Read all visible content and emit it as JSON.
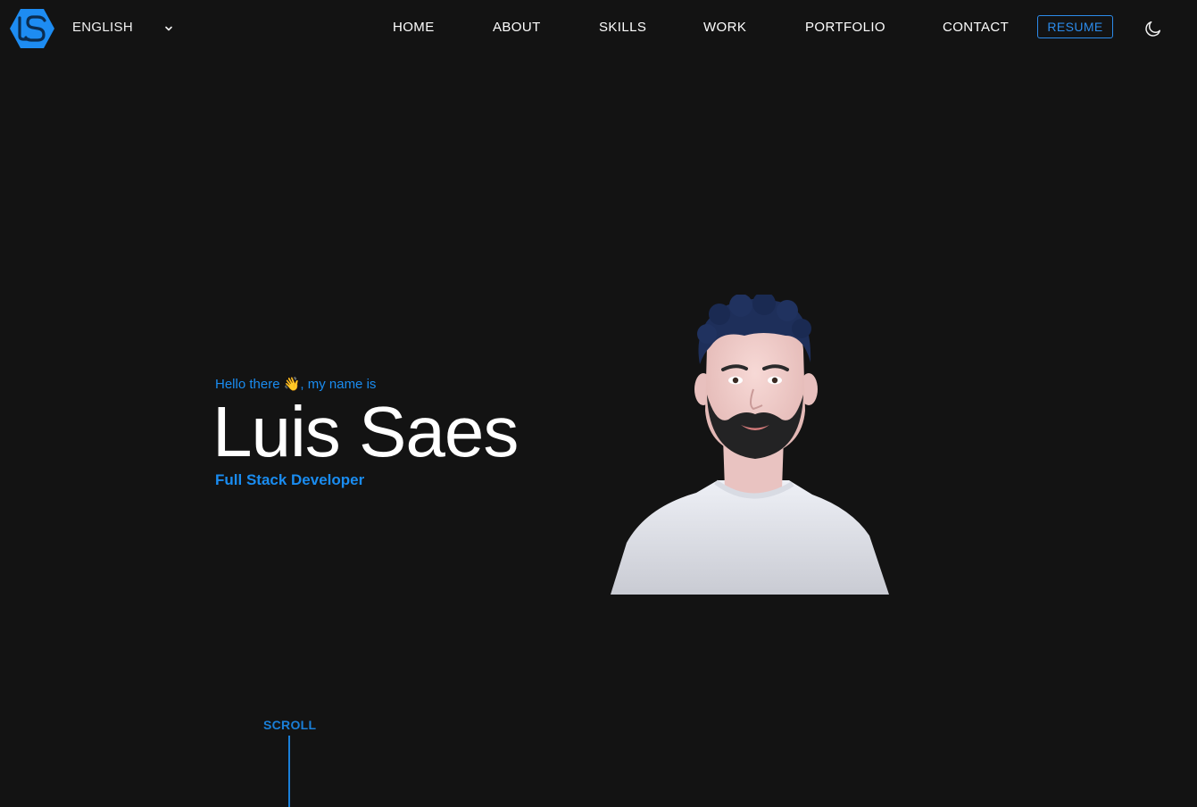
{
  "header": {
    "language": "ENGLISH",
    "nav": [
      {
        "id": "home",
        "label": "HOME"
      },
      {
        "id": "about",
        "label": "ABOUT"
      },
      {
        "id": "skills",
        "label": "SKILLS"
      },
      {
        "id": "work",
        "label": "WORK"
      },
      {
        "id": "portfolio",
        "label": "PORTFOLIO"
      },
      {
        "id": "contact",
        "label": "CONTACT"
      }
    ],
    "resume_label": "RESUME"
  },
  "hero": {
    "greeting": "Hello there 👋, my name is",
    "name": "Luis Saes",
    "role": "Full Stack Developer"
  },
  "scroll": {
    "label": "SCROLL"
  },
  "colors": {
    "background": "#131313",
    "accent": "#1a8cf0",
    "text": "#ffffff"
  },
  "icons": {
    "logo": "ls-hexagon-logo",
    "language_dropdown": "chevron-down-icon",
    "theme_toggle": "moon-icon"
  }
}
